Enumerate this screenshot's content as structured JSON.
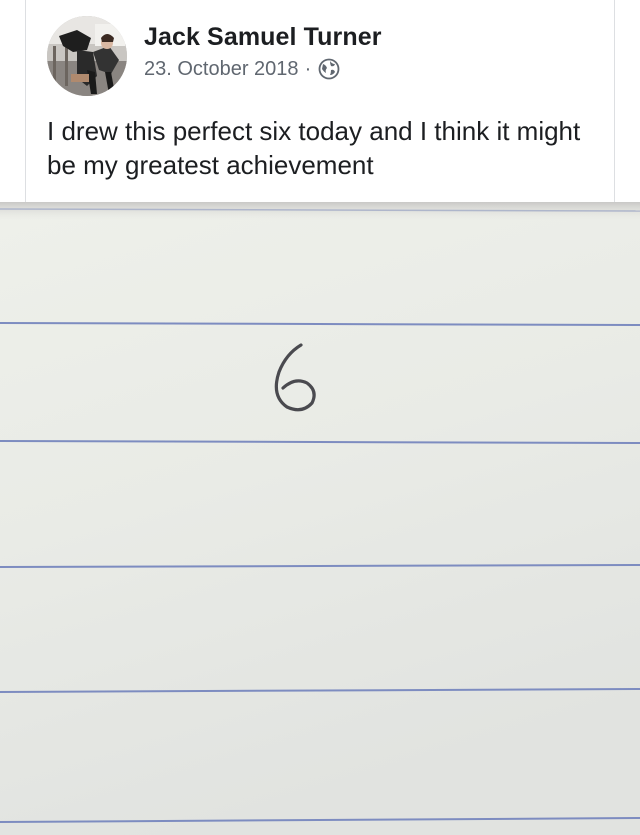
{
  "post": {
    "author_name": "Jack Samuel Turner",
    "date": "23. October 2018",
    "separator": "·",
    "privacy_icon": "globe-icon",
    "text": "I drew this perfect six today and I think it might be my greatest achievement"
  },
  "photo": {
    "handwritten_digit": "6"
  }
}
